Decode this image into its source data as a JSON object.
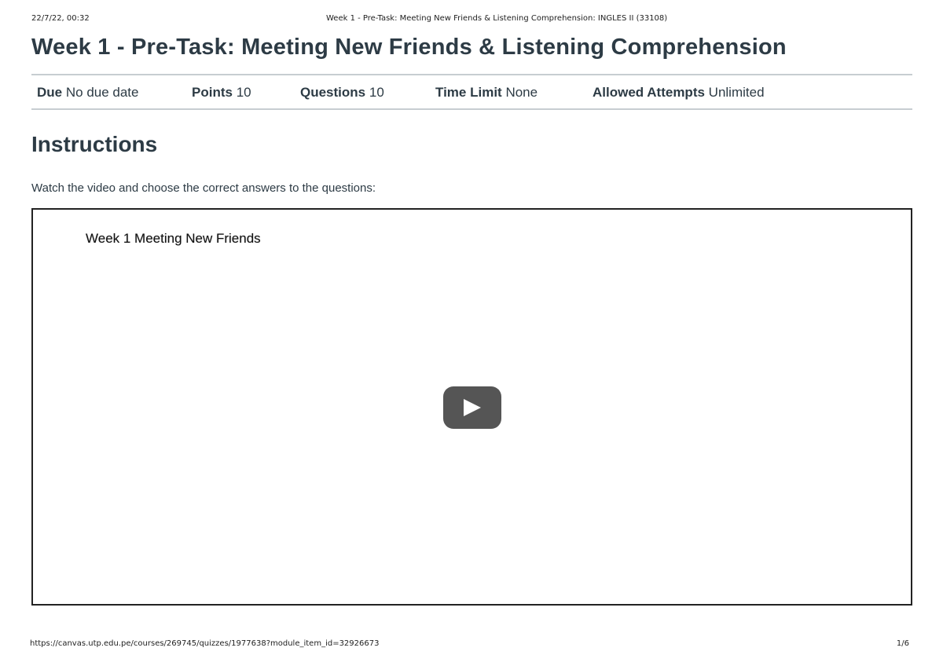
{
  "print_header": {
    "date": "22/7/22, 00:32",
    "document_title": "Week 1 - Pre-Task: Meeting New Friends & Listening Comprehension: INGLES II (33108)"
  },
  "quiz": {
    "title": "Week 1 - Pre-Task: Meeting New Friends & Listening Comprehension",
    "details": {
      "due_label": "Due",
      "due_value": "No due date",
      "points_label": "Points",
      "points_value": "10",
      "questions_label": "Questions",
      "questions_value": "10",
      "time_limit_label": "Time Limit",
      "time_limit_value": "None",
      "attempts_label": "Allowed Attempts",
      "attempts_value": "Unlimited"
    }
  },
  "instructions": {
    "heading": "Instructions",
    "text": "Watch the video and choose the correct answers to the questions:"
  },
  "video": {
    "title": "Week 1 Meeting New Friends",
    "play_icon": "play-icon",
    "play_button_color": "#555555"
  },
  "print_footer": {
    "url": "https://canvas.utp.edu.pe/courses/269745/quizzes/1977638?module_item_id=32926673",
    "page": "1/6"
  },
  "colors": {
    "text": "#2d3b45",
    "divider": "#c7cdd1",
    "frame_border": "#222222"
  }
}
